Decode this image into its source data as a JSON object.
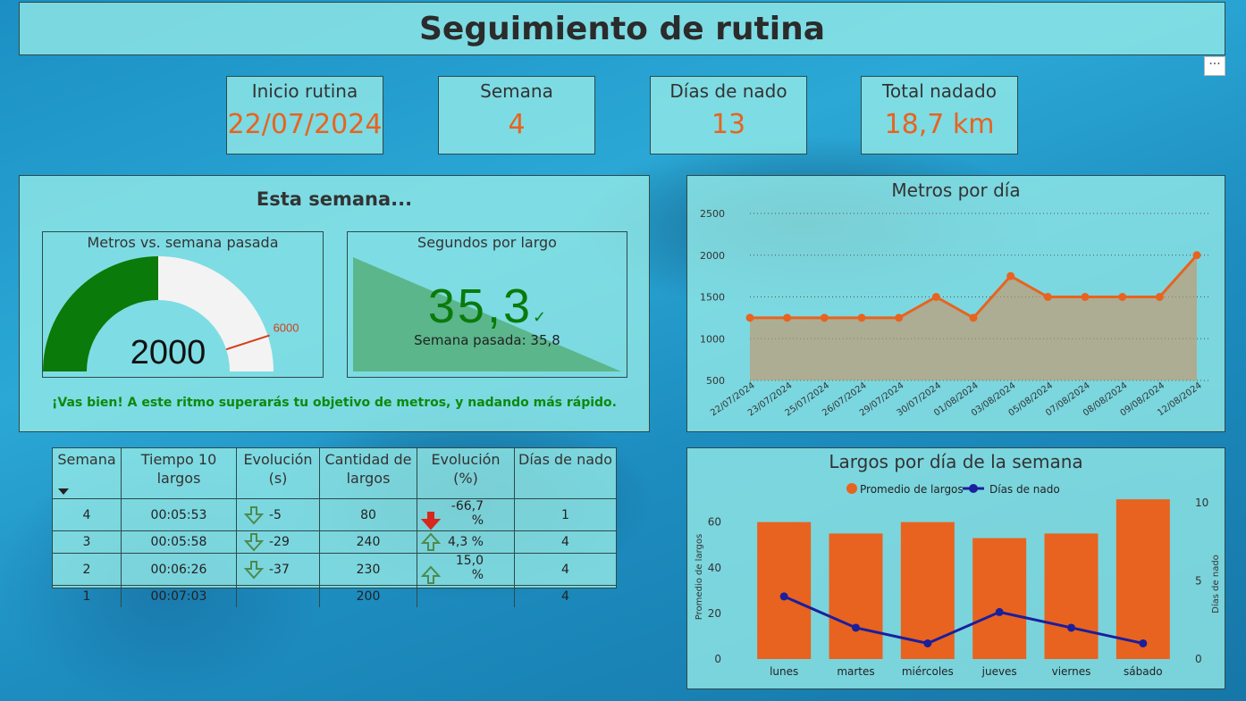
{
  "title": "Seguimiento de rutina",
  "more_label": "···",
  "kpis": [
    {
      "label": "Inicio rutina",
      "value": "22/07/2024"
    },
    {
      "label": "Semana",
      "value": "4"
    },
    {
      "label": "Días de nado",
      "value": "13"
    },
    {
      "label": "Total nadado",
      "value": "18,7 km"
    }
  ],
  "esta_semana": {
    "heading": "Esta semana...",
    "gauge": {
      "title": "Metros vs. semana pasada",
      "value": 2000,
      "value_label": "2000",
      "max": 4000,
      "target": 3600,
      "target_label": "6000",
      "fill_color": "#0a7a0a",
      "target_color": "#d2401c"
    },
    "secs": {
      "title": "Segundos por largo",
      "value": "35,3",
      "check": "✓",
      "prev_label": "Semana pasada: 35,8"
    },
    "message": "¡Vas bien! A este ritmo superarás tu objetivo de metros, y nadando más rápido."
  },
  "table": {
    "headers": [
      "Semana",
      "Tiempo 10 largos",
      "Evolución (s)",
      "Cantidad de largos",
      "Evolución (%)",
      "Días de nado"
    ],
    "rows": [
      {
        "semana": "4",
        "tiempo": "00:05:53",
        "evo_s": "-5",
        "evo_s_icon": "down-green",
        "cantidad": "80",
        "evo_pct": "-66,7 %",
        "evo_pct_icon": "down-red",
        "dias": "1"
      },
      {
        "semana": "3",
        "tiempo": "00:05:58",
        "evo_s": "-29",
        "evo_s_icon": "down-green",
        "cantidad": "240",
        "evo_pct": "4,3 %",
        "evo_pct_icon": "up-green",
        "dias": "4"
      },
      {
        "semana": "2",
        "tiempo": "00:06:26",
        "evo_s": "-37",
        "evo_s_icon": "down-green",
        "cantidad": "230",
        "evo_pct": "15,0 %",
        "evo_pct_icon": "up-green",
        "dias": "4"
      },
      {
        "semana": "1",
        "tiempo": "00:07:03",
        "evo_s": "",
        "evo_s_icon": "",
        "cantidad": "200",
        "evo_pct": "",
        "evo_pct_icon": "",
        "dias": "4"
      }
    ]
  },
  "chart_data": [
    {
      "type": "area",
      "title": "Metros por día",
      "x": [
        "22/07/2024",
        "23/07/2024",
        "25/07/2024",
        "26/07/2024",
        "29/07/2024",
        "30/07/2024",
        "01/08/2024",
        "03/08/2024",
        "05/08/2024",
        "07/08/2024",
        "08/08/2024",
        "09/08/2024",
        "12/08/2024"
      ],
      "values": [
        1250,
        1250,
        1250,
        1250,
        1250,
        1500,
        1250,
        1750,
        1500,
        1500,
        1500,
        1500,
        2000
      ],
      "ylim": [
        500,
        2500
      ],
      "yticks": [
        500,
        1000,
        1500,
        2000,
        2500
      ],
      "color": "#e8631f",
      "grid": true
    },
    {
      "type": "bar",
      "title": "Largos por día de la semana",
      "categories": [
        "lunes",
        "martes",
        "miércoles",
        "jueves",
        "viernes",
        "sábado"
      ],
      "series": [
        {
          "name": "Promedio de largos",
          "type": "bar",
          "axis": "left",
          "values": [
            60,
            55,
            60,
            53,
            55,
            70
          ],
          "color": "#e8631f"
        },
        {
          "name": "Días de nado",
          "type": "line",
          "axis": "right",
          "values": [
            4,
            2,
            1,
            3,
            2,
            1
          ],
          "color": "#1a1f9c"
        }
      ],
      "ylabel": "Promedio de largos",
      "y2label": "Días de nado",
      "ylim": [
        0,
        72
      ],
      "yticks": [
        0,
        20,
        40,
        60
      ],
      "y2lim": [
        0,
        10.5
      ],
      "y2ticks": [
        0,
        5,
        10
      ],
      "legend": "top"
    }
  ]
}
